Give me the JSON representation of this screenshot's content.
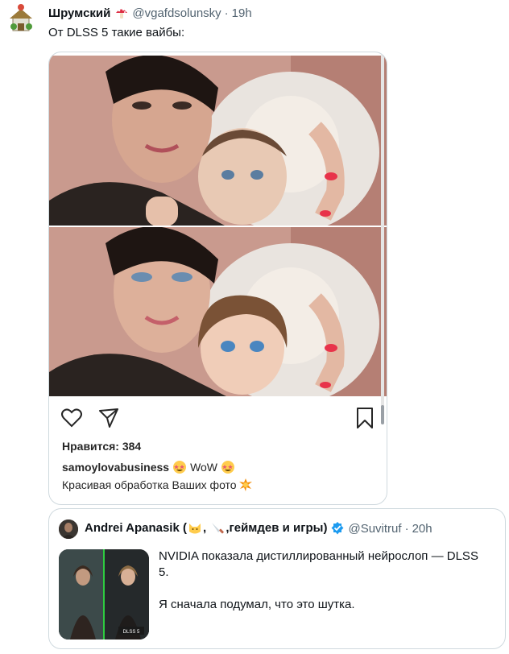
{
  "tweet": {
    "display_name": "Шрумский",
    "handle": "@vgafdsolunsky",
    "separator": "·",
    "time": "19h",
    "text": "От DLSS 5 такие вайбы:"
  },
  "instagram_post": {
    "likes": "Нравится: 384",
    "caption_user": "samoylovabusiness",
    "caption_wow": "WoW",
    "caption_text": "Красивая обработка Ваших фото"
  },
  "quoted_tweet": {
    "display_name": "Andrei Apanasik (",
    "name_mid": ",",
    "name_tail": ",геймдев и игры)",
    "handle": "@Suvitruf",
    "separator": "·",
    "time": "20h",
    "text_line1": "NVIDIA показала дистиллированный нейрослоп — DLSS 5.",
    "text_line2": "Я сначала подумал, что это шутка.",
    "thumb_caption": "DLSS 5"
  },
  "colors": {
    "text_primary": "#0f1419",
    "text_secondary": "#536471",
    "border": "#cfd9de",
    "verified": "#1d9bf0"
  },
  "icons": [
    "mushroom-emoji",
    "heart-icon",
    "share-icon",
    "bookmark-icon",
    "star-struck-emoji",
    "collision-emoji",
    "cat-emoji",
    "knife-emoji",
    "verified-badge-icon"
  ]
}
